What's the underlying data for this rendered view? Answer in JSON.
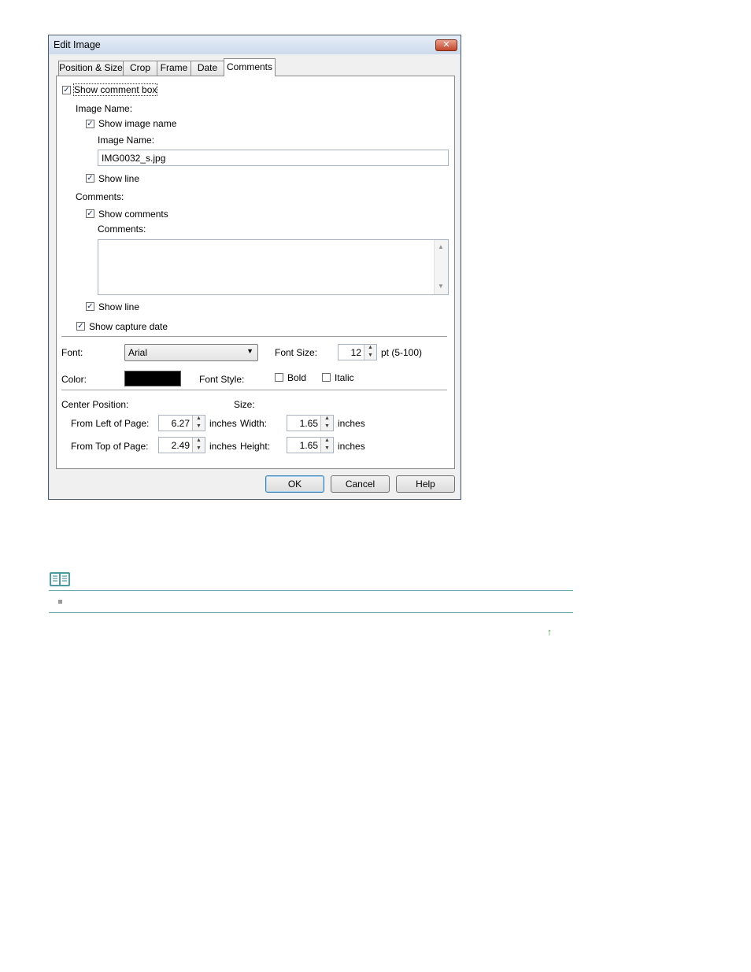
{
  "dialog": {
    "title": "Edit Image",
    "close_glyph": "✕",
    "tabs": [
      {
        "label": "Position & Size"
      },
      {
        "label": "Crop"
      },
      {
        "label": "Frame"
      },
      {
        "label": "Date"
      },
      {
        "label": "Comments"
      }
    ],
    "active_tab": "Comments",
    "show_comment_box": {
      "label": "Show comment box",
      "checked": true
    },
    "image_name_group": {
      "heading": "Image Name:",
      "show_image_name": {
        "label": "Show image name",
        "checked": true
      },
      "field_label": "Image Name:",
      "field_value": "IMG0032_s.jpg",
      "show_line": {
        "label": "Show line",
        "checked": true
      }
    },
    "comments_group": {
      "heading": "Comments:",
      "show_comments": {
        "label": "Show comments",
        "checked": true
      },
      "field_label": "Comments:",
      "field_value": "",
      "show_line": {
        "label": "Show line",
        "checked": true
      }
    },
    "show_capture_date": {
      "label": "Show capture date",
      "checked": true
    },
    "font": {
      "label": "Font:",
      "value": "Arial"
    },
    "font_size": {
      "label": "Font Size:",
      "value": "12",
      "unit": "pt (5-100)"
    },
    "color": {
      "label": "Color:",
      "value": "#000000"
    },
    "font_style": {
      "label": "Font Style:",
      "bold": {
        "label": "Bold",
        "checked": false
      },
      "italic": {
        "label": "Italic",
        "checked": false
      }
    },
    "center_position": {
      "heading": "Center Position:",
      "from_left": {
        "label": "From Left of Page:",
        "value": "6.27",
        "unit": "inches"
      },
      "from_top": {
        "label": "From Top of Page:",
        "value": "2.49",
        "unit": "inches"
      }
    },
    "size": {
      "heading": "Size:",
      "width": {
        "label": "Width:",
        "value": "1.65",
        "unit": "inches"
      },
      "height": {
        "label": "Height:",
        "value": "1.65",
        "unit": "inches"
      }
    },
    "buttons": {
      "ok": "OK",
      "cancel": "Cancel",
      "help": "Help"
    },
    "check_glyph": "✓",
    "spin_up": "▲",
    "spin_down": "▼",
    "dropdown_glyph": "▼"
  },
  "note": {
    "icon": "book-icon",
    "bullet_text": "",
    "page_top_glyph": "↑"
  },
  "colors": {
    "dialog_frame": "#d9e4f1",
    "rule": "#5a9ea6",
    "link": "#2e8b2e"
  }
}
